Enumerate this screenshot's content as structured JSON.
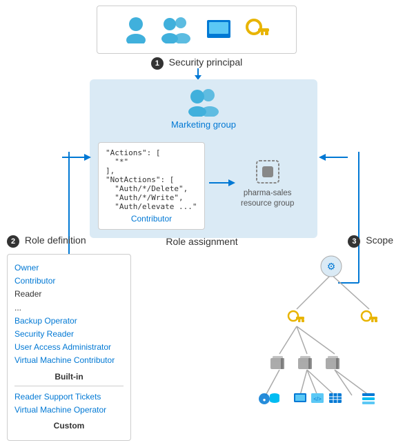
{
  "security_principal": {
    "label": "Security principal",
    "circle_num": "1"
  },
  "role_assignment": {
    "label": "Role assignment",
    "group_name": "Marketing group",
    "role_def_code": "\"Actions\": [\n  \"*\"\n],\n\"NotActions\": [\n  \"Auth/*/Delete\",\n  \"Auth/*/Write\",\n  \"Auth/elevate ...\"",
    "role_name": "Contributor",
    "resource_name": "pharma-sales\nresource group"
  },
  "role_definition": {
    "label": "Role definition",
    "circle_num": "2",
    "built_in": {
      "title": "Built-in",
      "items": [
        {
          "text": "Owner",
          "link": true
        },
        {
          "text": "Contributor",
          "link": true
        },
        {
          "text": "Reader",
          "link": false
        },
        {
          "text": "...",
          "link": false
        },
        {
          "text": "Backup Operator",
          "link": true
        },
        {
          "text": "Security Reader",
          "link": true
        },
        {
          "text": "User Access Administrator",
          "link": true
        },
        {
          "text": "Virtual Machine Contributor",
          "link": true
        }
      ]
    },
    "custom": {
      "title": "Custom",
      "items": [
        {
          "text": "Reader Support Tickets",
          "link": true
        },
        {
          "text": "Virtual Machine Operator",
          "link": true
        }
      ]
    }
  },
  "scope": {
    "label": "Scope",
    "circle_num": "3"
  }
}
